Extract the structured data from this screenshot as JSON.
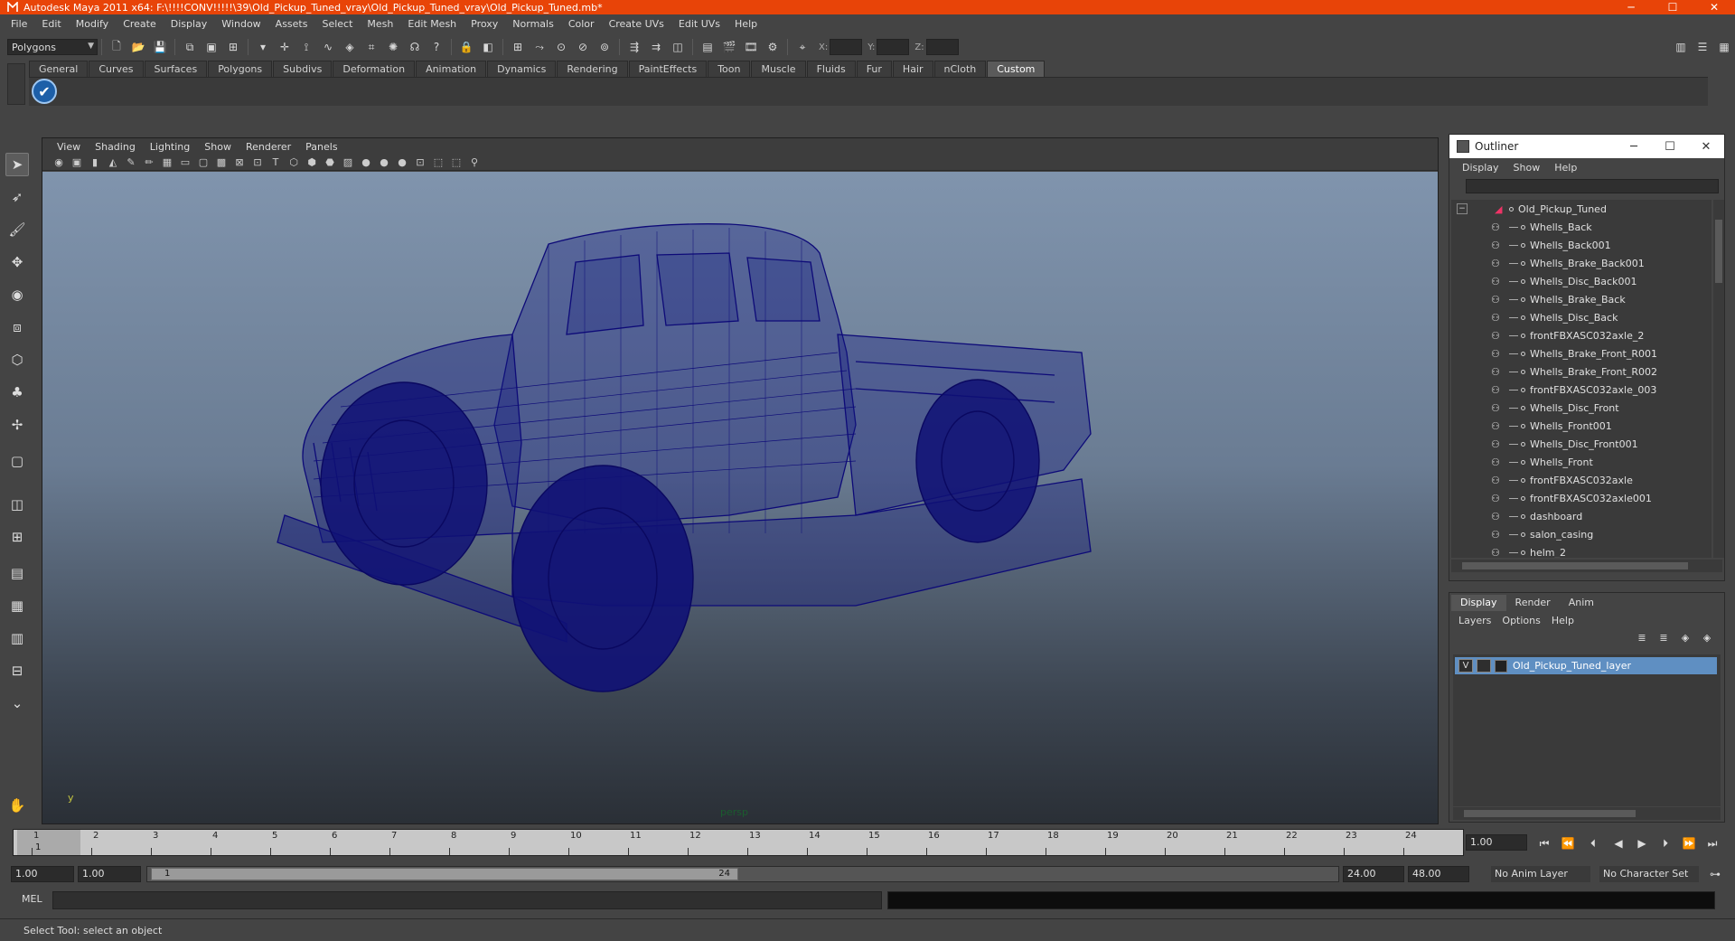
{
  "window": {
    "title": "Autodesk Maya 2011 x64: F:\\!!!!CONV!!!!!\\39\\Old_Pickup_Tuned_vray\\Old_Pickup_Tuned_vray\\Old_Pickup_Tuned.mb*",
    "minimize": "─",
    "maximize": "☐",
    "close": "✕"
  },
  "menubar": [
    "File",
    "Edit",
    "Modify",
    "Create",
    "Display",
    "Window",
    "Assets",
    "Select",
    "Mesh",
    "Edit Mesh",
    "Proxy",
    "Normals",
    "Color",
    "Create UVs",
    "Edit UVs",
    "Help"
  ],
  "statusline": {
    "mode": "Polygons",
    "x_label": "X:",
    "y_label": "Y:",
    "z_label": "Z:"
  },
  "shelf": {
    "tabs": [
      "General",
      "Curves",
      "Surfaces",
      "Polygons",
      "Subdivs",
      "Deformation",
      "Animation",
      "Dynamics",
      "Rendering",
      "PaintEffects",
      "Toon",
      "Muscle",
      "Fluids",
      "Fur",
      "Hair",
      "nCloth",
      "Custom"
    ],
    "active_tab": "Custom"
  },
  "viewport": {
    "menu": [
      "View",
      "Shading",
      "Lighting",
      "Show",
      "Renderer",
      "Panels"
    ],
    "camera_label": "persp",
    "axis_label": "y",
    "wire_color": "#0d0a78"
  },
  "outliner": {
    "title": "Outliner",
    "menu": [
      "Display",
      "Show",
      "Help"
    ],
    "root": "Old_Pickup_Tuned",
    "items": [
      "Whells_Back",
      "Whells_Back001",
      "Whells_Brake_Back001",
      "Whells_Disc_Back001",
      "Whells_Brake_Back",
      "Whells_Disc_Back",
      "frontFBXASC032axle_2",
      "Whells_Brake_Front_R001",
      "Whells_Brake_Front_R002",
      "frontFBXASC032axle_003",
      "Whells_Disc_Front",
      "Whells_Front001",
      "Whells_Disc_Front001",
      "Whells_Front",
      "frontFBXASC032axle",
      "frontFBXASC032axle001",
      "dashboard",
      "salon_casing",
      "helm_2"
    ]
  },
  "layers": {
    "tabs": [
      "Display",
      "Render",
      "Anim"
    ],
    "active_tab": "Display",
    "menu": [
      "Layers",
      "Options",
      "Help"
    ],
    "layer_visible": "V",
    "layer_name": "Old_Pickup_Tuned_layer"
  },
  "timeline": {
    "ticks": [
      "1",
      "2",
      "3",
      "4",
      "5",
      "6",
      "7",
      "8",
      "9",
      "10",
      "11",
      "12",
      "13",
      "14",
      "15",
      "16",
      "17",
      "18",
      "19",
      "20",
      "21",
      "22",
      "23",
      "24"
    ],
    "current_frame": "1",
    "current_time_field": "1.00"
  },
  "range": {
    "start_time": "1.00",
    "playback_start": "1.00",
    "range_start": "1",
    "range_end": "24",
    "playback_end": "24.00",
    "end_time": "48.00",
    "anim_layer": "No Anim Layer",
    "character_set": "No Character Set"
  },
  "mel": {
    "label": "MEL"
  },
  "helpline": {
    "text": "Select Tool: select an object"
  }
}
